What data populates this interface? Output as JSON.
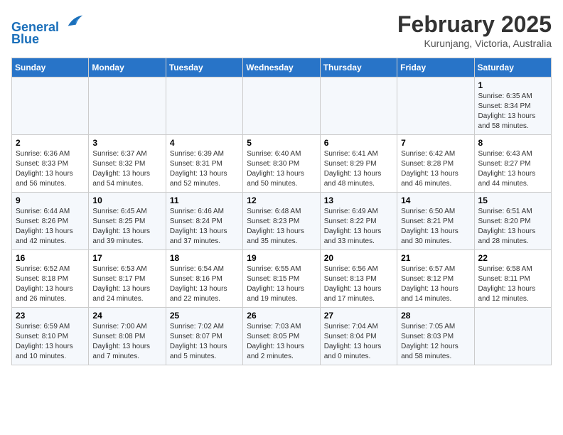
{
  "header": {
    "logo_line1": "General",
    "logo_line2": "Blue",
    "month": "February 2025",
    "location": "Kurunjang, Victoria, Australia"
  },
  "weekdays": [
    "Sunday",
    "Monday",
    "Tuesday",
    "Wednesday",
    "Thursday",
    "Friday",
    "Saturday"
  ],
  "weeks": [
    [
      {
        "day": "",
        "info": ""
      },
      {
        "day": "",
        "info": ""
      },
      {
        "day": "",
        "info": ""
      },
      {
        "day": "",
        "info": ""
      },
      {
        "day": "",
        "info": ""
      },
      {
        "day": "",
        "info": ""
      },
      {
        "day": "1",
        "info": "Sunrise: 6:35 AM\nSunset: 8:34 PM\nDaylight: 13 hours\nand 58 minutes."
      }
    ],
    [
      {
        "day": "2",
        "info": "Sunrise: 6:36 AM\nSunset: 8:33 PM\nDaylight: 13 hours\nand 56 minutes."
      },
      {
        "day": "3",
        "info": "Sunrise: 6:37 AM\nSunset: 8:32 PM\nDaylight: 13 hours\nand 54 minutes."
      },
      {
        "day": "4",
        "info": "Sunrise: 6:39 AM\nSunset: 8:31 PM\nDaylight: 13 hours\nand 52 minutes."
      },
      {
        "day": "5",
        "info": "Sunrise: 6:40 AM\nSunset: 8:30 PM\nDaylight: 13 hours\nand 50 minutes."
      },
      {
        "day": "6",
        "info": "Sunrise: 6:41 AM\nSunset: 8:29 PM\nDaylight: 13 hours\nand 48 minutes."
      },
      {
        "day": "7",
        "info": "Sunrise: 6:42 AM\nSunset: 8:28 PM\nDaylight: 13 hours\nand 46 minutes."
      },
      {
        "day": "8",
        "info": "Sunrise: 6:43 AM\nSunset: 8:27 PM\nDaylight: 13 hours\nand 44 minutes."
      }
    ],
    [
      {
        "day": "9",
        "info": "Sunrise: 6:44 AM\nSunset: 8:26 PM\nDaylight: 13 hours\nand 42 minutes."
      },
      {
        "day": "10",
        "info": "Sunrise: 6:45 AM\nSunset: 8:25 PM\nDaylight: 13 hours\nand 39 minutes."
      },
      {
        "day": "11",
        "info": "Sunrise: 6:46 AM\nSunset: 8:24 PM\nDaylight: 13 hours\nand 37 minutes."
      },
      {
        "day": "12",
        "info": "Sunrise: 6:48 AM\nSunset: 8:23 PM\nDaylight: 13 hours\nand 35 minutes."
      },
      {
        "day": "13",
        "info": "Sunrise: 6:49 AM\nSunset: 8:22 PM\nDaylight: 13 hours\nand 33 minutes."
      },
      {
        "day": "14",
        "info": "Sunrise: 6:50 AM\nSunset: 8:21 PM\nDaylight: 13 hours\nand 30 minutes."
      },
      {
        "day": "15",
        "info": "Sunrise: 6:51 AM\nSunset: 8:20 PM\nDaylight: 13 hours\nand 28 minutes."
      }
    ],
    [
      {
        "day": "16",
        "info": "Sunrise: 6:52 AM\nSunset: 8:18 PM\nDaylight: 13 hours\nand 26 minutes."
      },
      {
        "day": "17",
        "info": "Sunrise: 6:53 AM\nSunset: 8:17 PM\nDaylight: 13 hours\nand 24 minutes."
      },
      {
        "day": "18",
        "info": "Sunrise: 6:54 AM\nSunset: 8:16 PM\nDaylight: 13 hours\nand 22 minutes."
      },
      {
        "day": "19",
        "info": "Sunrise: 6:55 AM\nSunset: 8:15 PM\nDaylight: 13 hours\nand 19 minutes."
      },
      {
        "day": "20",
        "info": "Sunrise: 6:56 AM\nSunset: 8:13 PM\nDaylight: 13 hours\nand 17 minutes."
      },
      {
        "day": "21",
        "info": "Sunrise: 6:57 AM\nSunset: 8:12 PM\nDaylight: 13 hours\nand 14 minutes."
      },
      {
        "day": "22",
        "info": "Sunrise: 6:58 AM\nSunset: 8:11 PM\nDaylight: 13 hours\nand 12 minutes."
      }
    ],
    [
      {
        "day": "23",
        "info": "Sunrise: 6:59 AM\nSunset: 8:10 PM\nDaylight: 13 hours\nand 10 minutes."
      },
      {
        "day": "24",
        "info": "Sunrise: 7:00 AM\nSunset: 8:08 PM\nDaylight: 13 hours\nand 7 minutes."
      },
      {
        "day": "25",
        "info": "Sunrise: 7:02 AM\nSunset: 8:07 PM\nDaylight: 13 hours\nand 5 minutes."
      },
      {
        "day": "26",
        "info": "Sunrise: 7:03 AM\nSunset: 8:05 PM\nDaylight: 13 hours\nand 2 minutes."
      },
      {
        "day": "27",
        "info": "Sunrise: 7:04 AM\nSunset: 8:04 PM\nDaylight: 13 hours\nand 0 minutes."
      },
      {
        "day": "28",
        "info": "Sunrise: 7:05 AM\nSunset: 8:03 PM\nDaylight: 12 hours\nand 58 minutes."
      },
      {
        "day": "",
        "info": ""
      }
    ]
  ]
}
